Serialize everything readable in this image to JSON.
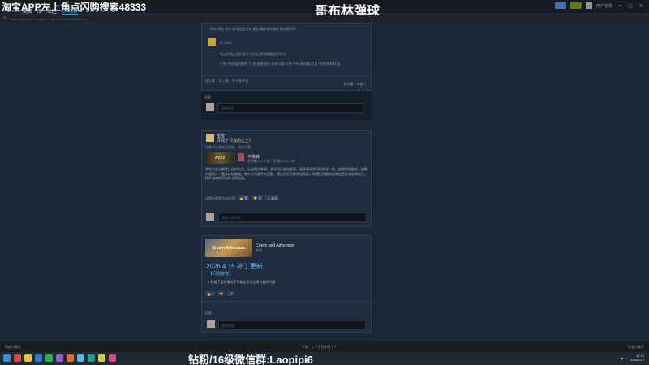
{
  "overlay": {
    "ad_text": "淘宝APP左上角点闪购搜索48333",
    "stream_title": "哥布林弹球",
    "bottom_text": "钻粉/16级微信群:Laopipi6"
  },
  "topbar": {
    "user_name": "用户名称",
    "colors": {
      "blue": "#3e73b0",
      "green": "#5c7e10"
    }
  },
  "nav": {
    "back": "←",
    "forward": "→",
    "items": [
      "商店",
      "库",
      "社区",
      "DY流群"
    ],
    "url": "https://steamcommunity.com/profiles/76561198/home"
  },
  "card1": {
    "line1": "很长,很长,很长,感觉就是很长,很长,确实很长很长很长很长啊",
    "user": "B_Lucid",
    "body1": "玩过的朋友说好像不太好玩,感觉就是很好玩吗",
    "body2": "只有 中间 有问题的 只 在 其他 部分 没有问题,只有 中间 有问题 而且 中间 非常 好 玩",
    "info": "显示第 1 至 2 条，共 9 条评论",
    "stat": "有价值 0   有趣 0"
  },
  "card1b": {
    "label": "回复",
    "placeholder": "添加评论"
  },
  "card2": {
    "name": "宝宝",
    "action_prefix": "评测了",
    "game": "《我的之王》",
    "meta": "如果对大家有过帮助，请点个赞",
    "game_img_label": "AVZZ",
    "verdict": "不推荐",
    "hours": "总时数 3.9 小时 / 评测时 3.0 小时",
    "review": "游戏大部分都是以动作为主，玩法相对单调，关卡设计缺乏新意。画面表现尚可但优化一般，加载时间较长。剧情内容较少，整体体验偏短。售价与内容不太匹配，建议打折后再考虑购买。希望后续更新能增加更多内容和玩法，提升游戏的可玩性与耐玩度。",
    "ask": "这篇评测是否有价值？",
    "btn_yes": "是",
    "btn_no": "否",
    "btn_funny": "欢乐",
    "comment_placeholder": "添加一则评论"
  },
  "card3": {
    "banner_label": "Crown Adventure",
    "game_name": "Crown and Adventure",
    "game_sub": "新闻",
    "headline": "2026.4.16 补丁更新",
    "tag": "【问题修复】",
    "bullet": "• 修复了某些情况下可能会无法正常存档的问题",
    "btn_like": "7",
    "btn_down": "",
    "btn_share": "",
    "label": "回复",
    "placeholder": "添加评论"
  },
  "statusbar": {
    "left": "朋友与聊天",
    "mid": "下载：1 个项目中的 1 个",
    "right": "好友与聊天"
  },
  "taskbar": {
    "time": "17:11",
    "date": "2026/4/16",
    "icon_colors": [
      "#3b8ed8",
      "#e24a3b",
      "#f2c23b",
      "#2f7ad6",
      "#2ab14b",
      "#9d5bd1",
      "#e66a2b",
      "#4fb7e0",
      "#1e9e8a",
      "#ccd23c",
      "#d94a8c"
    ]
  }
}
